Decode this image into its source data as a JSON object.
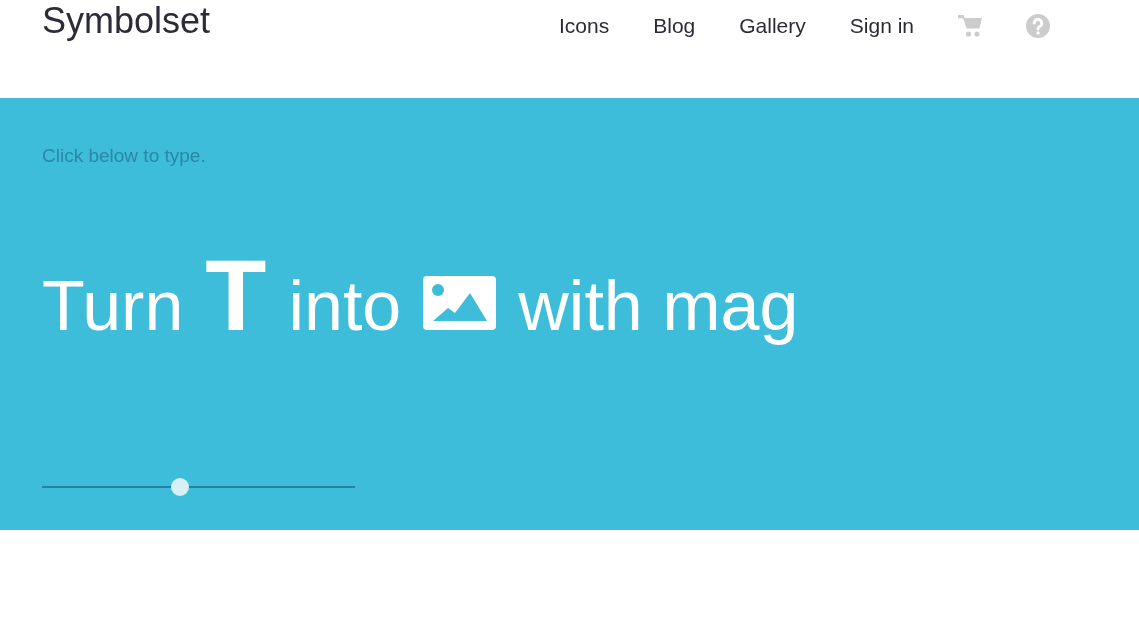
{
  "header": {
    "logo": "Symbolset",
    "nav": [
      "Icons",
      "Blog",
      "Gallery",
      "Sign in"
    ]
  },
  "hero": {
    "prompt": "Click below to type.",
    "line": [
      {
        "kind": "text",
        "text": "Turn"
      },
      {
        "kind": "glyph",
        "text": "T"
      },
      {
        "kind": "text",
        "text": "into"
      },
      {
        "kind": "image"
      },
      {
        "kind": "text",
        "text": "with mag"
      }
    ],
    "size_slider": {
      "level": 0.44
    }
  }
}
